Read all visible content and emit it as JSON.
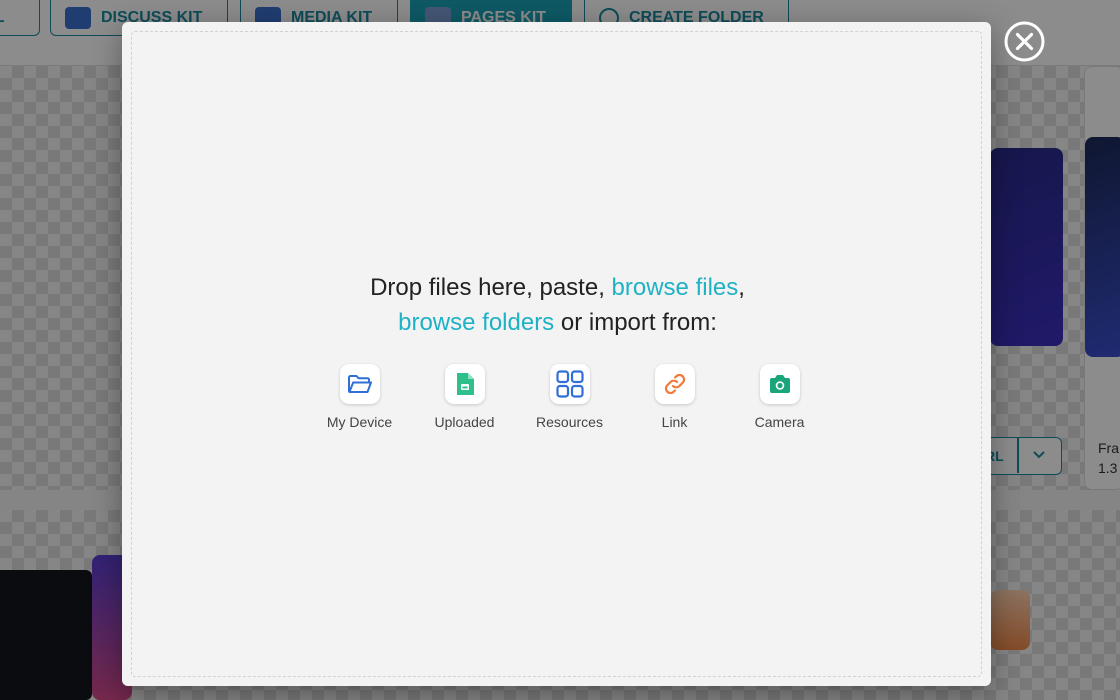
{
  "background": {
    "toolbar_buttons": [
      {
        "label": "LL"
      },
      {
        "label": "DISCUSS KIT"
      },
      {
        "label": "MEDIA KIT"
      },
      {
        "label": "PAGES KIT"
      },
      {
        "label": "CREATE FOLDER"
      }
    ],
    "url_button_label": "RL",
    "card_title": "Fra",
    "card_meta": "1.3"
  },
  "modal": {
    "drop_prefix": "Drop files here, paste, ",
    "browse_files": "browse files",
    "comma": ",",
    "browse_folders": "browse folders",
    "drop_suffix": " or import from:",
    "sources": [
      {
        "label": "My Device",
        "icon": "folder-open-icon",
        "color": "#2f6fd6"
      },
      {
        "label": "Uploaded",
        "icon": "uploaded-file-icon",
        "color": "#2fbf8a"
      },
      {
        "label": "Resources",
        "icon": "grid-icon",
        "color": "#2f6fd6"
      },
      {
        "label": "Link",
        "icon": "link-icon",
        "color": "#f07a3a"
      },
      {
        "label": "Camera",
        "icon": "camera-icon",
        "color": "#1aa67a"
      }
    ]
  },
  "colors": {
    "accent": "#1fb1c6",
    "modal_bg": "#f3f3f3"
  }
}
